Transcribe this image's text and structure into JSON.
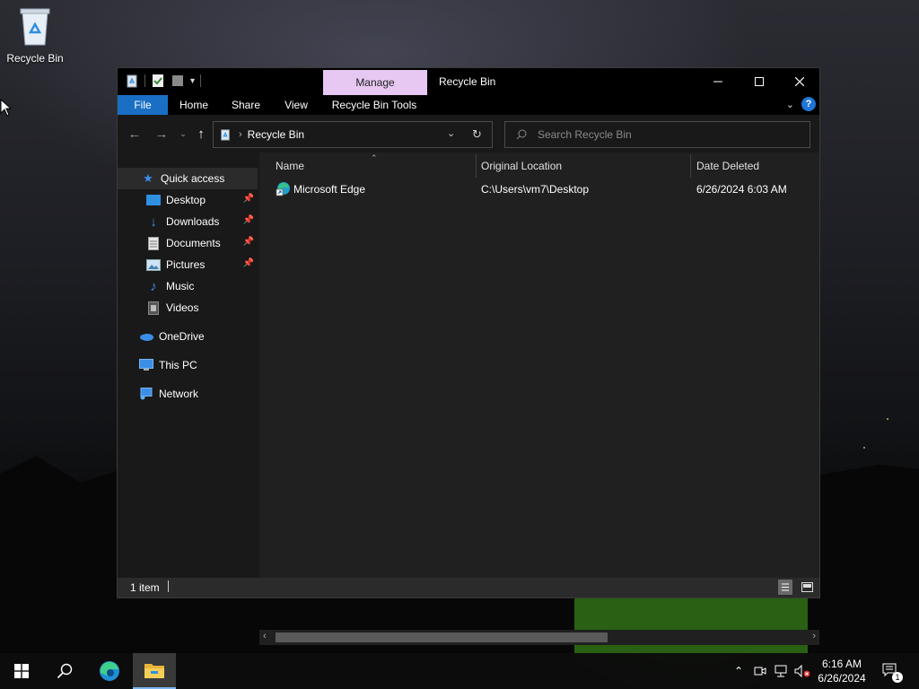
{
  "desktop": {
    "recycle_bin_label": "Recycle Bin"
  },
  "window": {
    "title": "Recycle Bin",
    "contextual_tab": "Manage",
    "ribbon_tabs": [
      "File",
      "Home",
      "Share",
      "View",
      "Recycle Bin Tools"
    ],
    "address": "Recycle Bin",
    "search_placeholder": "Search Recycle Bin",
    "status_text": "1 item"
  },
  "sidebar": {
    "quick_access": "Quick access",
    "items": [
      {
        "label": "Desktop",
        "pinned": true
      },
      {
        "label": "Downloads",
        "pinned": true
      },
      {
        "label": "Documents",
        "pinned": true
      },
      {
        "label": "Pictures",
        "pinned": true
      },
      {
        "label": "Music",
        "pinned": false
      },
      {
        "label": "Videos",
        "pinned": false
      }
    ],
    "onedrive": "OneDrive",
    "this_pc": "This PC",
    "network": "Network"
  },
  "columns": {
    "name": "Name",
    "original_location": "Original Location",
    "date_deleted": "Date Deleted"
  },
  "files": [
    {
      "name": "Microsoft Edge",
      "original_location": "C:\\Users\\vm7\\Desktop",
      "date_deleted": "6/26/2024 6:03 AM"
    }
  ],
  "taskbar": {
    "time": "6:16 AM",
    "date": "6/26/2024",
    "notification_count": "1"
  },
  "colors": {
    "file_tab": "#1a6fc4",
    "manage_tab": "#e7c8f2",
    "window_bg": "#191919",
    "content_bg": "#202020"
  }
}
